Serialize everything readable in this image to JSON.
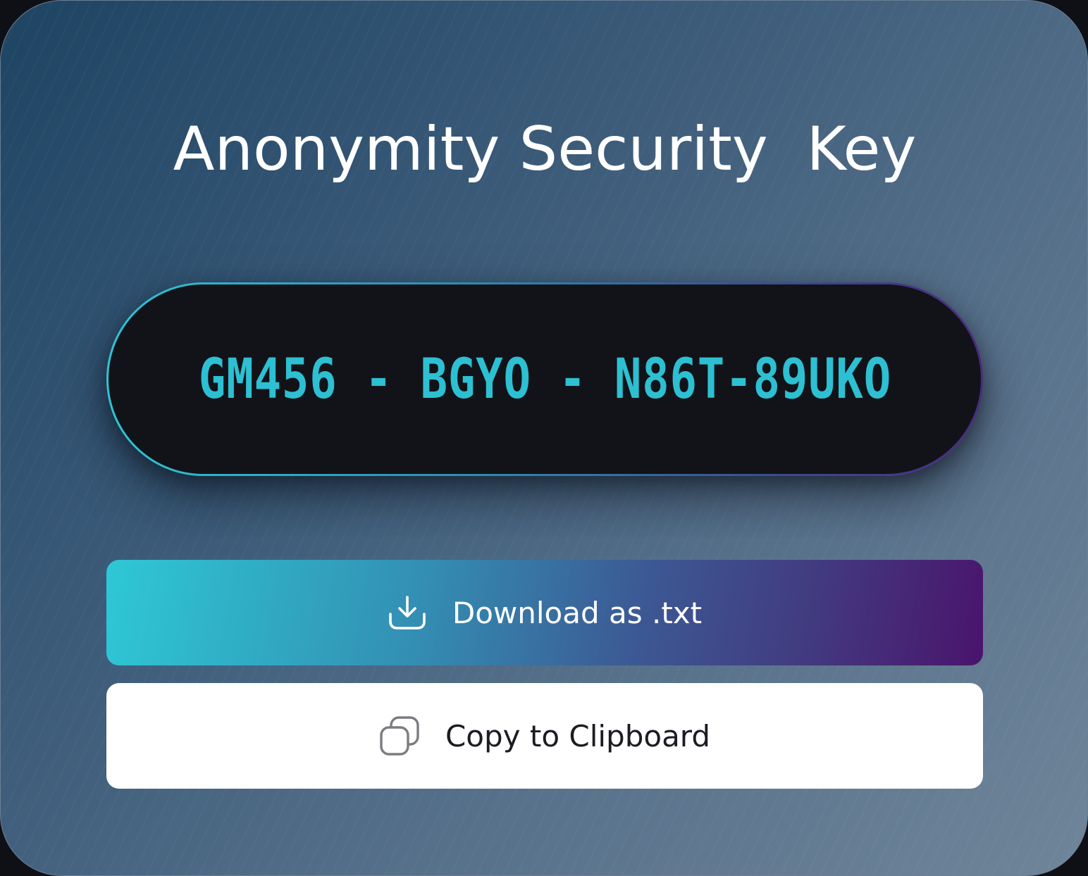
{
  "title": "Anonymity Security  Key",
  "security_key": "GM456 - BGYO - N86T-89UKO",
  "buttons": {
    "download": {
      "label": "Download as .txt",
      "icon": "download-icon"
    },
    "copy": {
      "label": "Copy to Clipboard",
      "icon": "copy-icon"
    }
  },
  "colors": {
    "key_text": "#2cc0d2",
    "pill_background": "#121318",
    "download_gradient_start": "#2ec8d6",
    "download_gradient_end": "#4a146c",
    "copy_background": "#ffffff"
  }
}
